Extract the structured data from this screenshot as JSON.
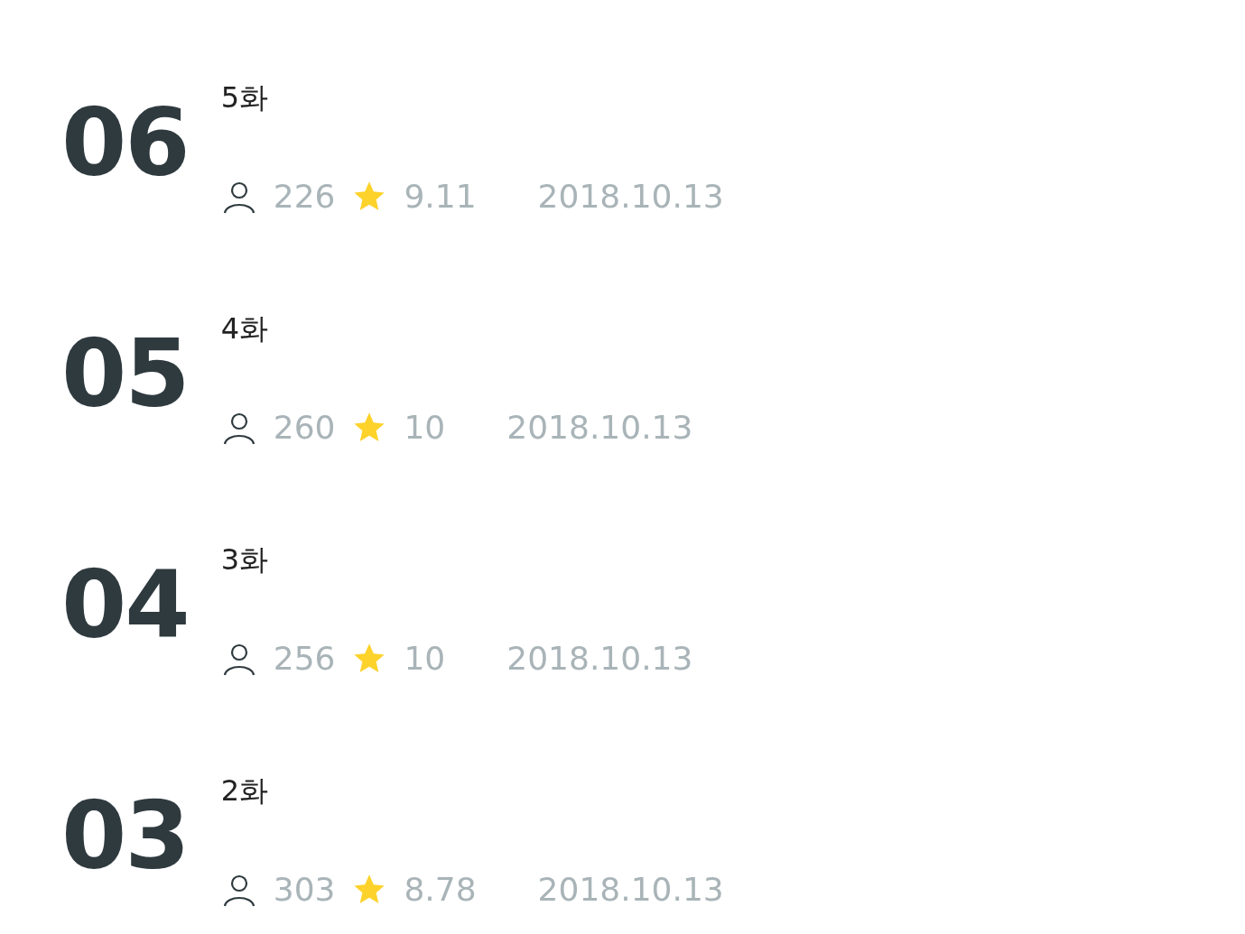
{
  "episodes": [
    {
      "number": "06",
      "title": "5화",
      "views": "226",
      "rating": "9.11",
      "date": "2018.10.13"
    },
    {
      "number": "05",
      "title": "4화",
      "views": "260",
      "rating": "10",
      "date": "2018.10.13"
    },
    {
      "number": "04",
      "title": "3화",
      "views": "256",
      "rating": "10",
      "date": "2018.10.13"
    },
    {
      "number": "03",
      "title": "2화",
      "views": "303",
      "rating": "8.78",
      "date": "2018.10.13"
    }
  ]
}
